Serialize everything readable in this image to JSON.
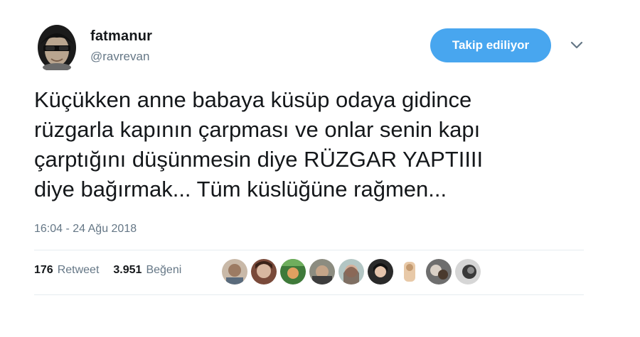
{
  "user": {
    "name": "fatmanur",
    "handle": "@ravrevan"
  },
  "follow_button": {
    "label": "Takip ediliyor",
    "color": "#48a6ef"
  },
  "tweet": {
    "lines": [
      "Küçükken anne babaya küsüp odaya gidince",
      "rüzgarla kapının çarpması ve onlar senin kapı",
      "çarptığını düşünmesin diye RÜZGAR YAPTIIII",
      "diye bağırmak... Tüm küslüğüne rağmen..."
    ],
    "timestamp": "16:04 - 24 Ağu 2018"
  },
  "stats": {
    "retweet_count": "176",
    "retweet_label": "Retweet",
    "like_count": "3.951",
    "like_label": "Beğeni"
  },
  "icons": {
    "caret": "chevron-down-icon"
  }
}
